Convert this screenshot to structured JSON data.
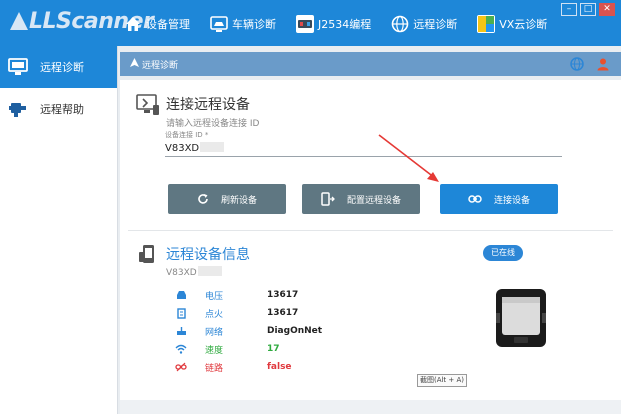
{
  "app": {
    "logo_text": "LLScanner"
  },
  "topnav": [
    {
      "label": "设备管理",
      "icon": "home-icon"
    },
    {
      "label": "车辆诊断",
      "icon": "car-diagnose-icon"
    },
    {
      "label": "J2534编程",
      "icon": "j2534-icon"
    },
    {
      "label": "远程诊断",
      "icon": "globe-icon"
    },
    {
      "label": "VX云诊断",
      "icon": "cloud-icon"
    }
  ],
  "window": {
    "minimize": "–",
    "maximize": "□",
    "close": "✕"
  },
  "sidebar": {
    "items": [
      {
        "label": "远程诊断",
        "active": true,
        "icon": "monitor-icon"
      },
      {
        "label": "远程帮助",
        "active": false,
        "icon": "help-plug-icon"
      }
    ]
  },
  "breadcrumb": {
    "label": "远程诊断"
  },
  "connect": {
    "title": "连接远程设备",
    "subtitle": "请输入远程设备连接 ID",
    "field_label": "设备连接 ID *",
    "field_value": "V83XD"
  },
  "buttons": {
    "refresh": "刷新设备",
    "configure": "配置远程设备",
    "connect": "连接设备"
  },
  "info": {
    "title": "远程设备信息",
    "device_id": "V83XD",
    "status_badge": "已在线",
    "rows": [
      {
        "label": "电压",
        "value": "13617",
        "color": "#2c86d6",
        "icon": "car-battery-icon"
      },
      {
        "label": "点火",
        "value": "13617",
        "color": "#2c86d6",
        "icon": "ignition-icon"
      },
      {
        "label": "网络",
        "value": "DiagOnNet",
        "color": "#2c86d6",
        "icon": "network-icon"
      },
      {
        "label": "速度",
        "value": "17",
        "color": "#2faa3f",
        "icon": "wifi-icon"
      },
      {
        "label": "链路",
        "value": "false",
        "color": "#e0393e",
        "icon": "link-broken-icon"
      }
    ],
    "tooltip": "截图(Alt + A)"
  },
  "colors": {
    "accent": "#1e87d8",
    "button_gray": "#5f7782",
    "online": "#2faa3f",
    "offline": "#e0393e"
  }
}
